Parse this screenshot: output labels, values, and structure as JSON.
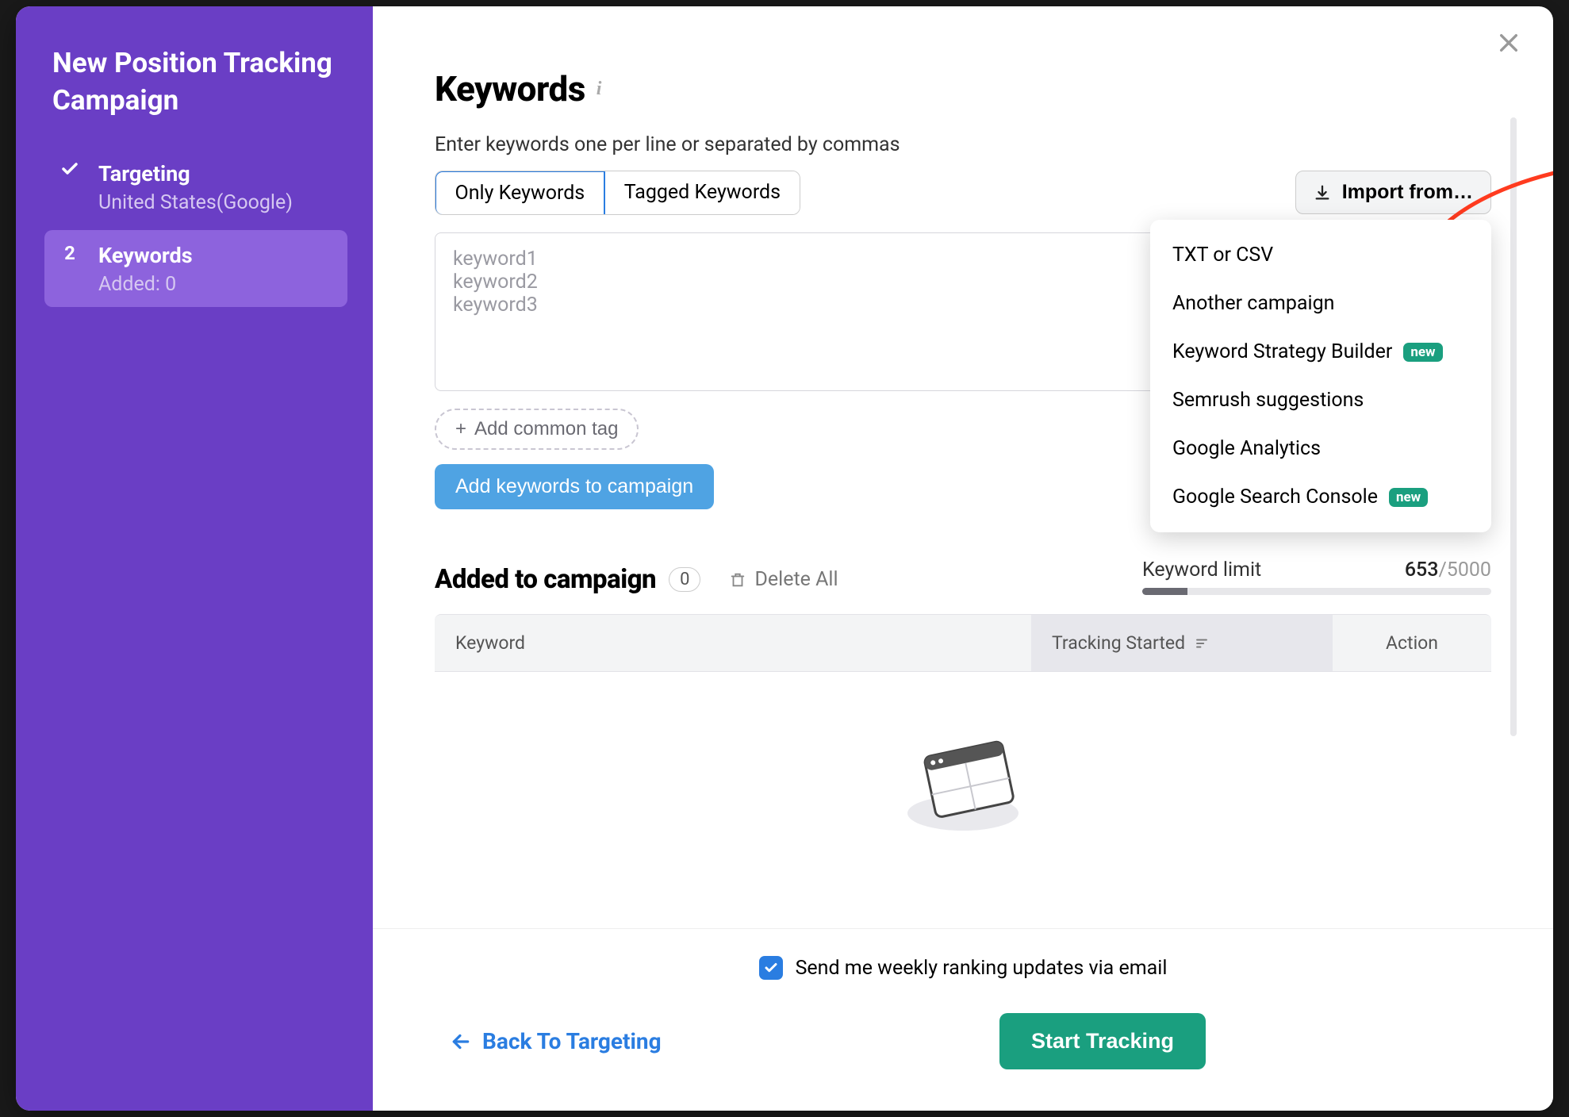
{
  "sidebar": {
    "title": "New Position Tracking Campaign",
    "steps": [
      {
        "label": "Targeting",
        "sub": "United States(Google)",
        "done": true
      },
      {
        "label": "Keywords",
        "sub": "Added: 0",
        "number": "2",
        "active": true
      }
    ]
  },
  "header": {
    "title": "Keywords",
    "helper": "Enter keywords one per line or separated by commas"
  },
  "tabs": {
    "only": "Only Keywords",
    "tagged": "Tagged Keywords"
  },
  "import": {
    "button": "Import from…",
    "options": [
      {
        "label": "TXT or CSV"
      },
      {
        "label": "Another campaign"
      },
      {
        "label": "Keyword Strategy Builder",
        "badge": "new"
      },
      {
        "label": "Semrush suggestions"
      },
      {
        "label": "Google Analytics"
      },
      {
        "label": "Google Search Console",
        "badge": "new"
      }
    ]
  },
  "textarea": {
    "placeholder": "keyword1\nkeyword2\nkeyword3"
  },
  "buttons": {
    "add_tag": "Add common tag",
    "add_keywords": "Add keywords to campaign"
  },
  "added": {
    "title": "Added to campaign",
    "count": "0",
    "delete_all": "Delete All"
  },
  "limit": {
    "label": "Keyword limit",
    "used": "653",
    "total": "/5000"
  },
  "table": {
    "col_keyword": "Keyword",
    "col_tracking": "Tracking Started",
    "col_action": "Action"
  },
  "footer": {
    "weekly": "Send me weekly ranking updates via email",
    "back": "Back To Targeting",
    "start": "Start Tracking"
  }
}
